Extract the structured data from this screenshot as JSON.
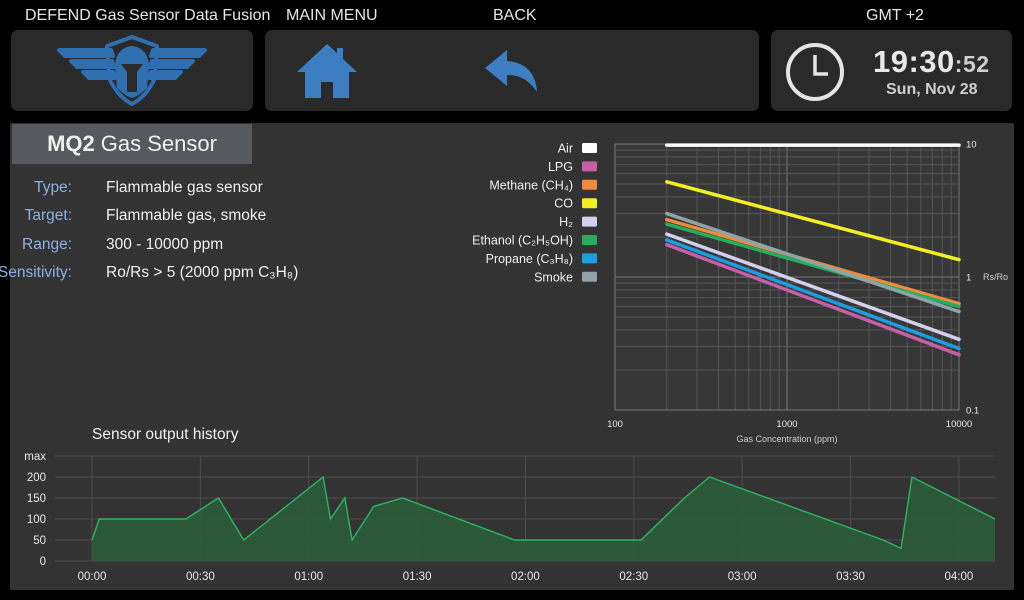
{
  "header": {
    "app_title": "DEFEND Gas Sensor Data Fusion",
    "main_menu_label": "MAIN MENU",
    "back_label": "BACK",
    "timezone": "GMT +2",
    "time_hm": "19:30",
    "time_sep": ":",
    "time_s": "52",
    "date": "Sun, Nov 28"
  },
  "sensor": {
    "name_bold": "MQ2",
    "name_rest": "Gas Sensor",
    "specs": [
      {
        "key": "Type:",
        "value": "Flammable gas sensor"
      },
      {
        "key": "Target:",
        "value": "Flammable gas, smoke"
      },
      {
        "key": "Range:",
        "value": "300 - 10000 ppm"
      },
      {
        "key": "Sensitivity:",
        "value": "Ro/Rs > 5 (2000 ppm C₃H₈)"
      }
    ]
  },
  "colors": {
    "accent_blue": "#2f6fb0",
    "label_blue": "#8fb0e6",
    "history_fill": "#2a5b3a",
    "history_line": "#2db463"
  },
  "chart_data": [
    {
      "type": "line",
      "log_x": true,
      "log_y": true,
      "xlabel": "Gas Concentration (ppm)",
      "ylabel": "Rs/Ro",
      "xlim": [
        100,
        10000
      ],
      "ylim": [
        0.1,
        10
      ],
      "xticks": [
        "100",
        "1000",
        "10000"
      ],
      "yticks": [
        "10",
        "1",
        "0.1"
      ],
      "grid": true,
      "legend_position": "top-left",
      "series": [
        {
          "name": "Air",
          "color": "#ffffff",
          "x": [
            200,
            10000
          ],
          "y": [
            9.8,
            9.8
          ]
        },
        {
          "name": "LPG",
          "color": "#c560a6",
          "x": [
            200,
            10000
          ],
          "y": [
            1.75,
            0.26
          ]
        },
        {
          "name": "Methane (CH₄)",
          "color": "#f08a3c",
          "x": [
            200,
            10000
          ],
          "y": [
            2.7,
            0.63
          ]
        },
        {
          "name": "CO",
          "color": "#f3f022",
          "x": [
            200,
            10000
          ],
          "y": [
            5.2,
            1.35
          ]
        },
        {
          "name": "H₂",
          "color": "#d3d0ee",
          "x": [
            200,
            10000
          ],
          "y": [
            2.1,
            0.34
          ]
        },
        {
          "name": "Ethanol (C₂H₅OH)",
          "color": "#27ae5c",
          "x": [
            200,
            10000
          ],
          "y": [
            2.5,
            0.6
          ]
        },
        {
          "name": "Propane (C₃H₈)",
          "color": "#1f9de2",
          "x": [
            200,
            10000
          ],
          "y": [
            1.9,
            0.29
          ]
        },
        {
          "name": "Smoke",
          "color": "#8fa3a8",
          "x": [
            200,
            10000
          ],
          "y": [
            3.0,
            0.55
          ]
        }
      ]
    },
    {
      "type": "area",
      "title": "Sensor output history",
      "yticks": [
        "max",
        "200",
        "150",
        "100",
        "50",
        "0"
      ],
      "ylim": [
        0,
        250
      ],
      "xlabels": [
        "00:00",
        "00:30",
        "01:00",
        "01:30",
        "02:00",
        "02:30",
        "03:00",
        "03:30",
        "04:00"
      ],
      "x_unit": "minutes",
      "xlim": [
        0,
        250
      ],
      "grid": true,
      "x": [
        0,
        2,
        26,
        35,
        42,
        64,
        66,
        70,
        72,
        78,
        86,
        117,
        133,
        152,
        164,
        171,
        219,
        224,
        227,
        250
      ],
      "y": [
        50,
        100,
        100,
        150,
        50,
        200,
        100,
        150,
        50,
        130,
        150,
        50,
        50,
        50,
        150,
        200,
        50,
        30,
        200,
        100
      ]
    }
  ]
}
